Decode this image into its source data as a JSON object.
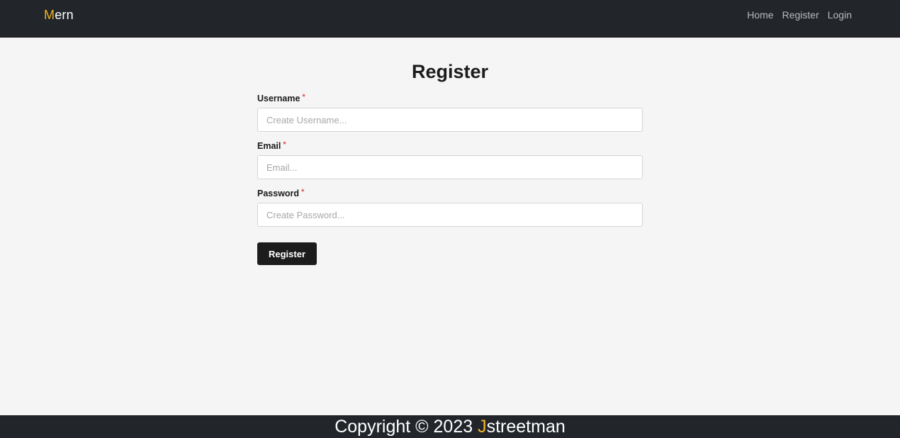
{
  "navbar": {
    "brand_accent": "M",
    "brand_rest": "ern",
    "links": [
      "Home",
      "Register",
      "Login"
    ]
  },
  "main": {
    "title": "Register",
    "fields": [
      {
        "label": "Username",
        "required_mark": "*",
        "placeholder": "Create Username...",
        "value": ""
      },
      {
        "label": "Email",
        "required_mark": "*",
        "placeholder": "Email...",
        "value": ""
      },
      {
        "label": "Password",
        "required_mark": "*",
        "placeholder": "Create Password...",
        "value": ""
      }
    ],
    "submit_label": "Register"
  },
  "footer": {
    "text_prefix": "Copyright © 2023 ",
    "accent": "J",
    "text_rest": "streetman"
  },
  "colors": {
    "accent": "#f0b323",
    "navbar_bg": "#22262b",
    "required": "#d9534f",
    "button_bg": "#1c1c1c"
  }
}
